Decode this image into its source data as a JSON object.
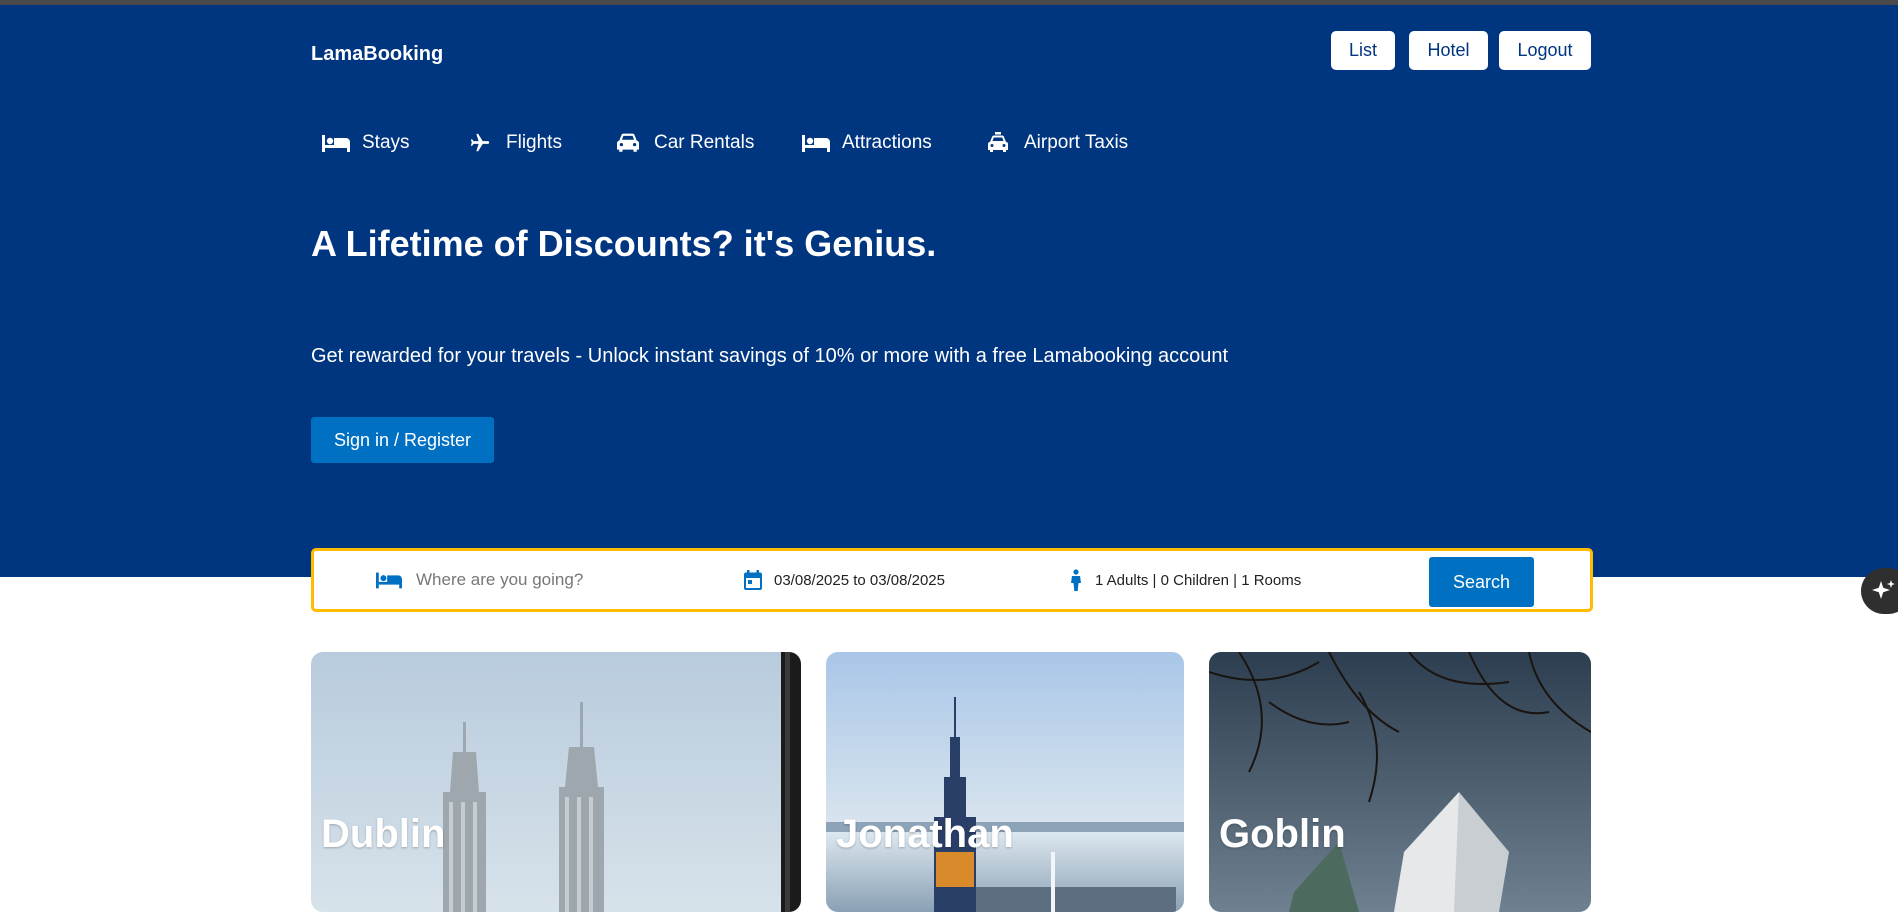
{
  "brand": "LamaBooking",
  "header_buttons": {
    "list": "List",
    "hotel": "Hotel",
    "logout": "Logout"
  },
  "nav_tabs": [
    {
      "label": "Stays",
      "icon": "bed-icon"
    },
    {
      "label": "Flights",
      "icon": "plane-icon"
    },
    {
      "label": "Car Rentals",
      "icon": "car-icon"
    },
    {
      "label": "Attractions",
      "icon": "bed-icon"
    },
    {
      "label": "Airport Taxis",
      "icon": "taxi-icon"
    }
  ],
  "hero": {
    "title": "A Lifetime of Discounts? it's Genius.",
    "description": "Get rewarded for your travels - Unlock instant savings of 10% or more with a free Lamabooking account",
    "signin_label": "Sign in / Register"
  },
  "search": {
    "destination_placeholder": "Where are you going?",
    "dates": "03/08/2025 to 03/08/2025",
    "occupancy": "1 Adults | 0 Children | 1 Rooms",
    "button_label": "Search"
  },
  "featured": [
    {
      "title": "Dublin"
    },
    {
      "title": "Jonathan"
    },
    {
      "title": "Goblin"
    }
  ],
  "colors": {
    "primary": "#003580",
    "accent": "#0071c2",
    "highlight": "#febb02"
  }
}
